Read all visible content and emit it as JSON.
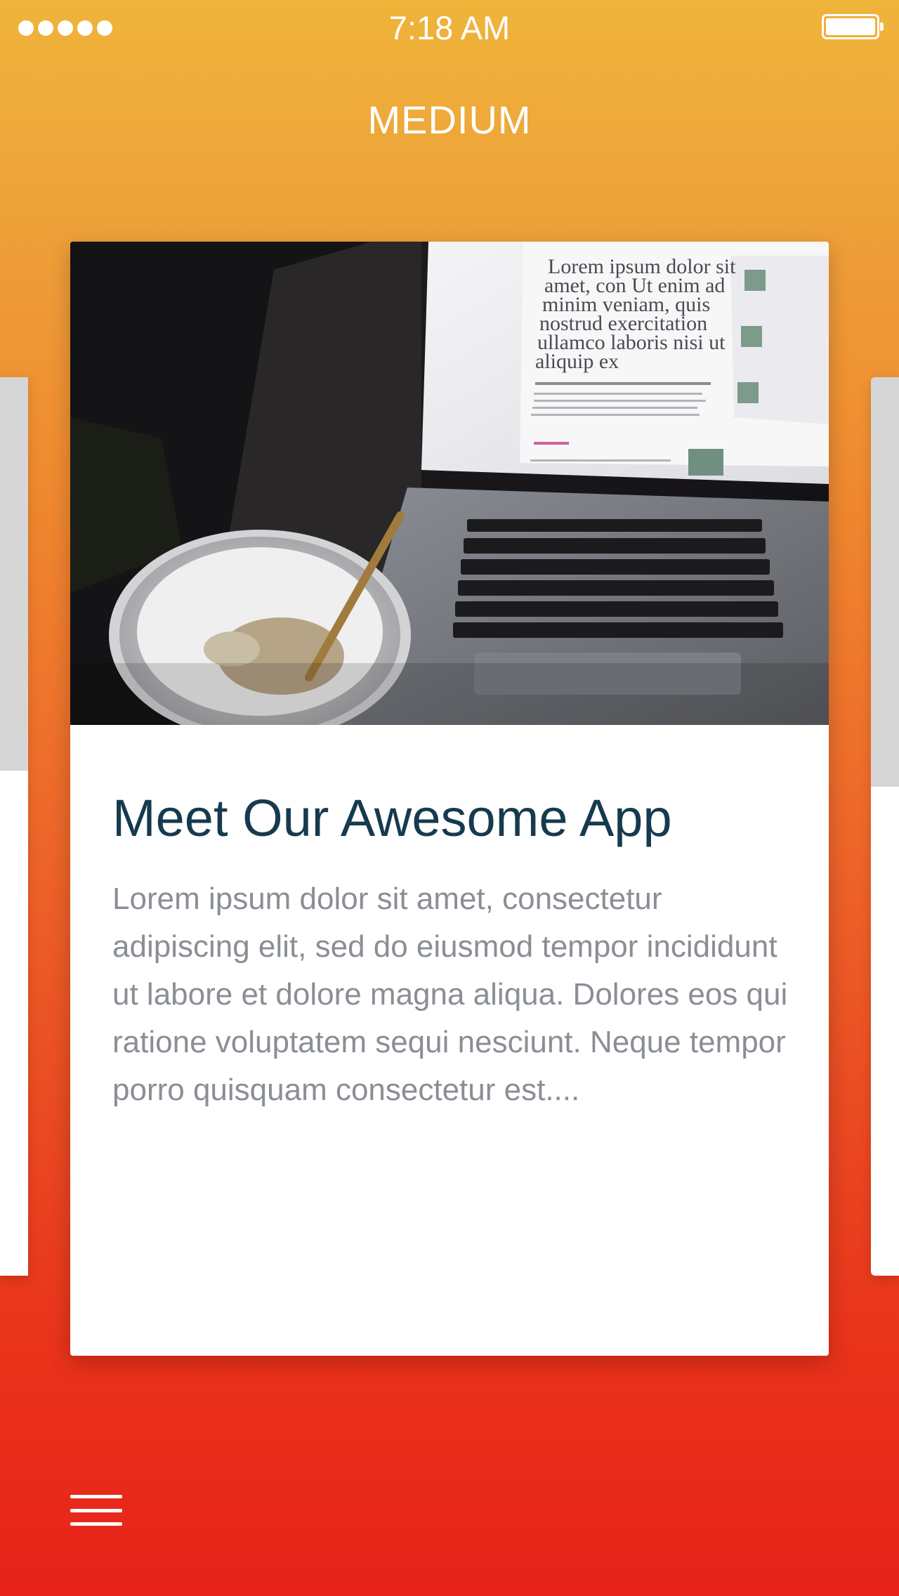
{
  "status_bar": {
    "time": "7:18 AM",
    "signal_icon": "signal-dots-icon",
    "battery_icon": "battery-full-icon"
  },
  "header": {
    "title": "MEDIUM"
  },
  "card": {
    "image_icon": "laptop-desk-photo",
    "title": "Meet Our Awesome App",
    "description": "Lorem ipsum dolor sit amet, consectetur adipiscing elit, sed do eiusmod tempor incididunt ut labore et dolore magna aliqua. Dolores eos qui ratione voluptatem sequi nesciunt. Neque tempor porro quisquam consectetur est....",
    "photo_text": "Lorem ipsum dolor sit amet, con Ut enim ad minim veniam, quis nostrud exercitation ullamco laboris nisi ut aliquip ex"
  },
  "footer": {
    "menu_icon": "hamburger-menu-icon"
  },
  "colors": {
    "gradient_top": "#efb43a",
    "gradient_bottom": "#e8231a",
    "title_color": "#163a4e",
    "text_color": "#8a8e95"
  }
}
